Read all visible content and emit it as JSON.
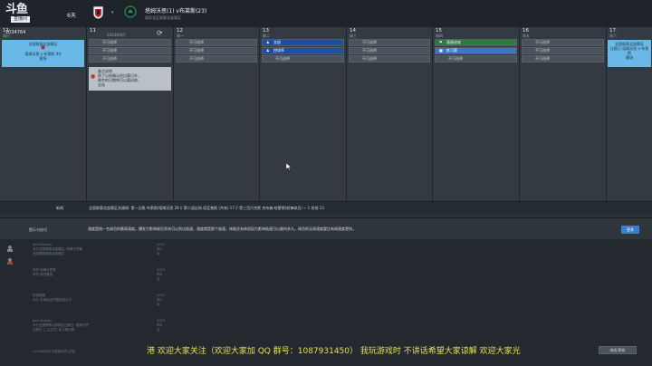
{
  "header": {
    "logo_text": "斗鱼",
    "logo_sub": "直播间",
    "days_label": "6天",
    "match_title": "塔姆沃思(1) v布莱斯(23)",
    "match_subtitle": "国家北区联赛北部赛区",
    "room_id": "1034764"
  },
  "calendar": {
    "columns": [
      {
        "num": "11",
        "weekday": "周日",
        "month": "2024年8月",
        "slots": [],
        "card": {
          "text": [
            "全国联赛北部赛区",
            "塔姆沃思",
            "塔姆沃思 v 布莱斯 (H)",
            "客场"
          ]
        }
      },
      {
        "num": "",
        "weekday": "",
        "slots": [
          "不可选择",
          "不可选择",
          "不可选择"
        ],
        "card2": {
          "text": [
            "备注说明",
            "除了以前确认的比赛日外，",
            "剩余的日期将可以赛训练、",
            "去选"
          ]
        }
      },
      {
        "num": "12",
        "weekday": "周一",
        "slots": [
          "不可选择",
          "不可选择",
          "不可选择"
        ]
      },
      {
        "num": "13",
        "weekday": "周二",
        "slots": [
          "全部",
          "控球率",
          "不可选择"
        ]
      },
      {
        "num": "14",
        "weekday": "周三",
        "slots": [
          "不可选择",
          "不可选择",
          "不可选择"
        ]
      },
      {
        "num": "15",
        "weekday": "周四",
        "slots": [
          "直接进攻",
          "练习赛",
          "不可选择"
        ]
      },
      {
        "num": "16",
        "weekday": "周五",
        "slots": [
          "不可选择",
          "不可选择",
          "不可选择"
        ]
      },
      {
        "num": "17",
        "weekday": "周六",
        "slots": [],
        "card": {
          "text": [
            "全国联赛北部赛区",
            "比赛日 塔姆沃思 v 布莱斯",
            "客场"
          ]
        }
      }
    ]
  },
  "news": {
    "label": "新闻",
    "text": "全国联赛北部赛区关键球: 第一边角 布莱斯/塔姆沃思 29 // 第二战出场 塔瓦普斯 (共有) 17 // 第三百尺克斯 杰布森·哈蒙德(前锋球员) ~ 1 其他 13"
  },
  "tips": {
    "label": "提示与技巧",
    "text": "速度是指一名球员的最高速度。爆发力影响球员多快可以到达极速，速度就是那个极速，体能还有体质因为影响极速可以维持多久。球员的无球速度要比有球速度更快。",
    "button": "更多"
  },
  "inbox": {
    "items": [
      {
        "from": "Jack Boullay",
        "line1": "对方全国联赛北部赛区: 塔姆沃思赛",
        "line2": "全国联赛联赛北部赛区",
        "date": "2024年8月"
      },
      {
        "from": "球员·塔姆沃思赛",
        "line1": "球员 情况赛选",
        "line2": "",
        "date": "2024年8月"
      },
      {
        "from": "科技新闻",
        "line1": "对方 本地队伍完整的结论中",
        "line2": "",
        "date": "2024年8月"
      },
      {
        "from": "Jack Boullay",
        "line1": "对方全国联赛北部赛区比赛日: 塔姆沃思",
        "line2": "比赛日 (二)(正式) 前几周比赛",
        "date": "2024年8月"
      },
      {
        "from": "2024年8月5日塔姆沃思(主场)",
        "line1": "",
        "line2": "",
        "date": ""
      }
    ]
  },
  "ticker": "港  欢迎大家关注（欢迎大家加 QQ 群号：1087931450）  我玩游戏时 不讲话希望大家谅解 欢迎大家光",
  "continue_button": "继续/更新",
  "colors": {
    "selected_blue": "#1c4f9e",
    "green": "#2e7d3a",
    "light_blue": "#3a78c2",
    "card_blue": "#6ab8e8",
    "ticker_yellow": "#e5e054"
  }
}
